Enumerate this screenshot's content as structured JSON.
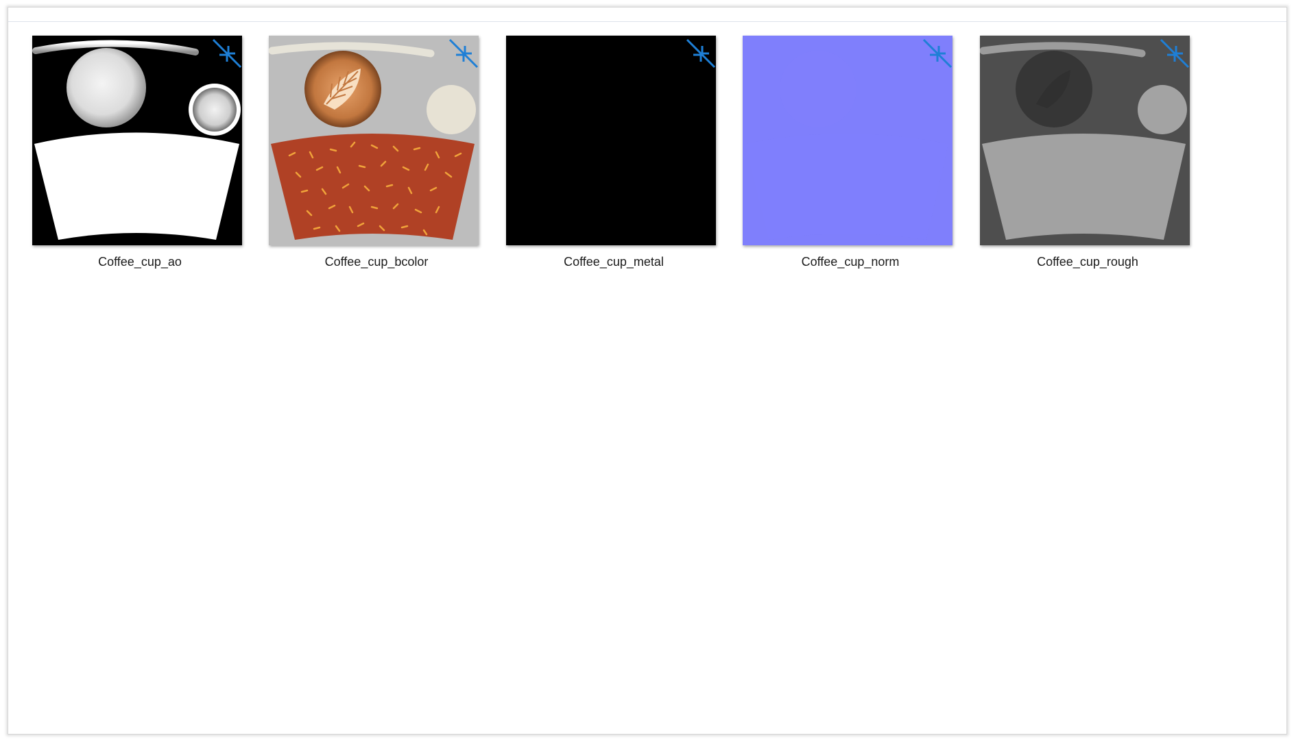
{
  "accent_color": "#1e7fd6",
  "overlay_icon": "compressed-arrows-icon",
  "files": [
    {
      "name": "Coffee_cup_ao",
      "preview": "ambient-occlusion-map"
    },
    {
      "name": "Coffee_cup_bcolor",
      "preview": "base-color-map"
    },
    {
      "name": "Coffee_cup_metal",
      "preview": "metallic-map"
    },
    {
      "name": "Coffee_cup_norm",
      "preview": "normal-map"
    },
    {
      "name": "Coffee_cup_rough",
      "preview": "roughness-map"
    }
  ]
}
